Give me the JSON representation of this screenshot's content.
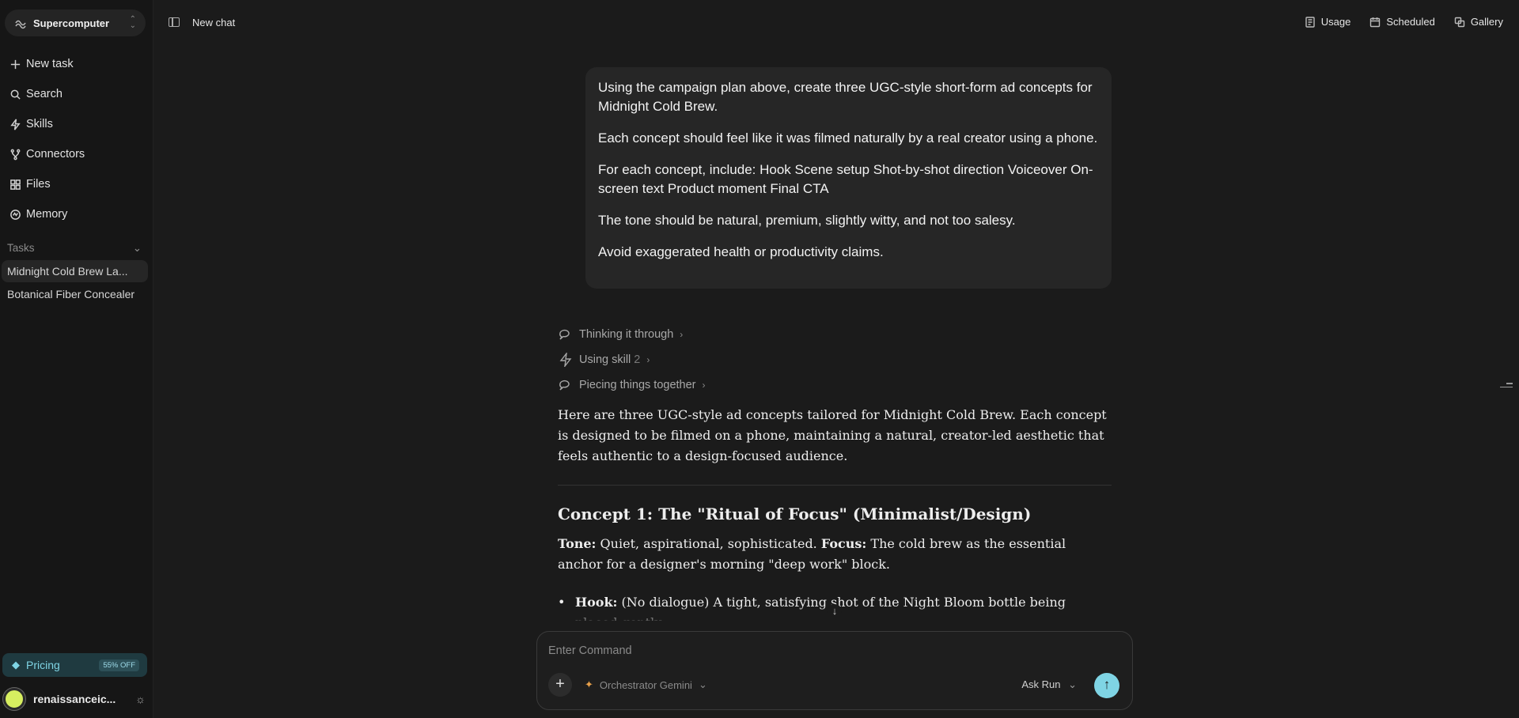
{
  "sidebar": {
    "workspace": "Supercomputer",
    "nav": [
      {
        "label": "New task",
        "icon": "plus-icon"
      },
      {
        "label": "Search",
        "icon": "search-icon"
      },
      {
        "label": "Skills",
        "icon": "lightning-icon"
      },
      {
        "label": "Connectors",
        "icon": "connectors-icon"
      },
      {
        "label": "Files",
        "icon": "grid-icon"
      },
      {
        "label": "Memory",
        "icon": "memory-icon"
      }
    ],
    "tasks_label": "Tasks",
    "tasks": [
      "Midnight Cold Brew La...",
      "Botanical Fiber Concealer"
    ],
    "pricing_label": "Pricing",
    "pricing_badge": "55% OFF",
    "username": "renaissanceic...",
    "accent_color": "#7fd4e4"
  },
  "header": {
    "title": "New chat",
    "actions": [
      {
        "label": "Usage",
        "icon": "usage-icon"
      },
      {
        "label": "Scheduled",
        "icon": "calendar-icon"
      },
      {
        "label": "Gallery",
        "icon": "gallery-icon"
      }
    ]
  },
  "user_message": [
    "Using the campaign plan above, create three UGC-style short-form ad concepts for Midnight Cold Brew.",
    "Each concept should feel like it was filmed naturally by a real creator using a phone.",
    "For each concept, include: Hook Scene setup Shot-by-shot direction Voiceover On-screen text Product moment Final CTA",
    "The tone should be natural, premium, slightly witty, and not too salesy.",
    "Avoid exaggerated health or productivity claims."
  ],
  "status_steps": [
    {
      "label": "Thinking it through",
      "count": ""
    },
    {
      "label": "Using skill",
      "count": "2"
    },
    {
      "label": "Piecing things together",
      "count": ""
    }
  ],
  "response": {
    "intro": "Here are three UGC-style ad concepts tailored for Midnight Cold Brew. Each concept is designed to be filmed on a phone, maintaining a natural, creator-led aesthetic that feels authentic to a design-focused audience.",
    "concept_title": "Concept 1: The \"Ritual of Focus\" (Minimalist/Design)",
    "tone_label": "Tone:",
    "tone_text": " Quiet, aspirational, sophisticated. ",
    "focus_label": "Focus:",
    "focus_text": " The cold brew as the essential anchor for a designer's morning \"deep work\" block.",
    "bullet_label": "Hook:",
    "bullet_text": " (No dialogue) A tight, satisfying shot of the Night Bloom bottle being placed gently"
  },
  "composer": {
    "placeholder": "Enter Command",
    "model": "Orchestrator Gemini",
    "mode": "Ask Run"
  }
}
